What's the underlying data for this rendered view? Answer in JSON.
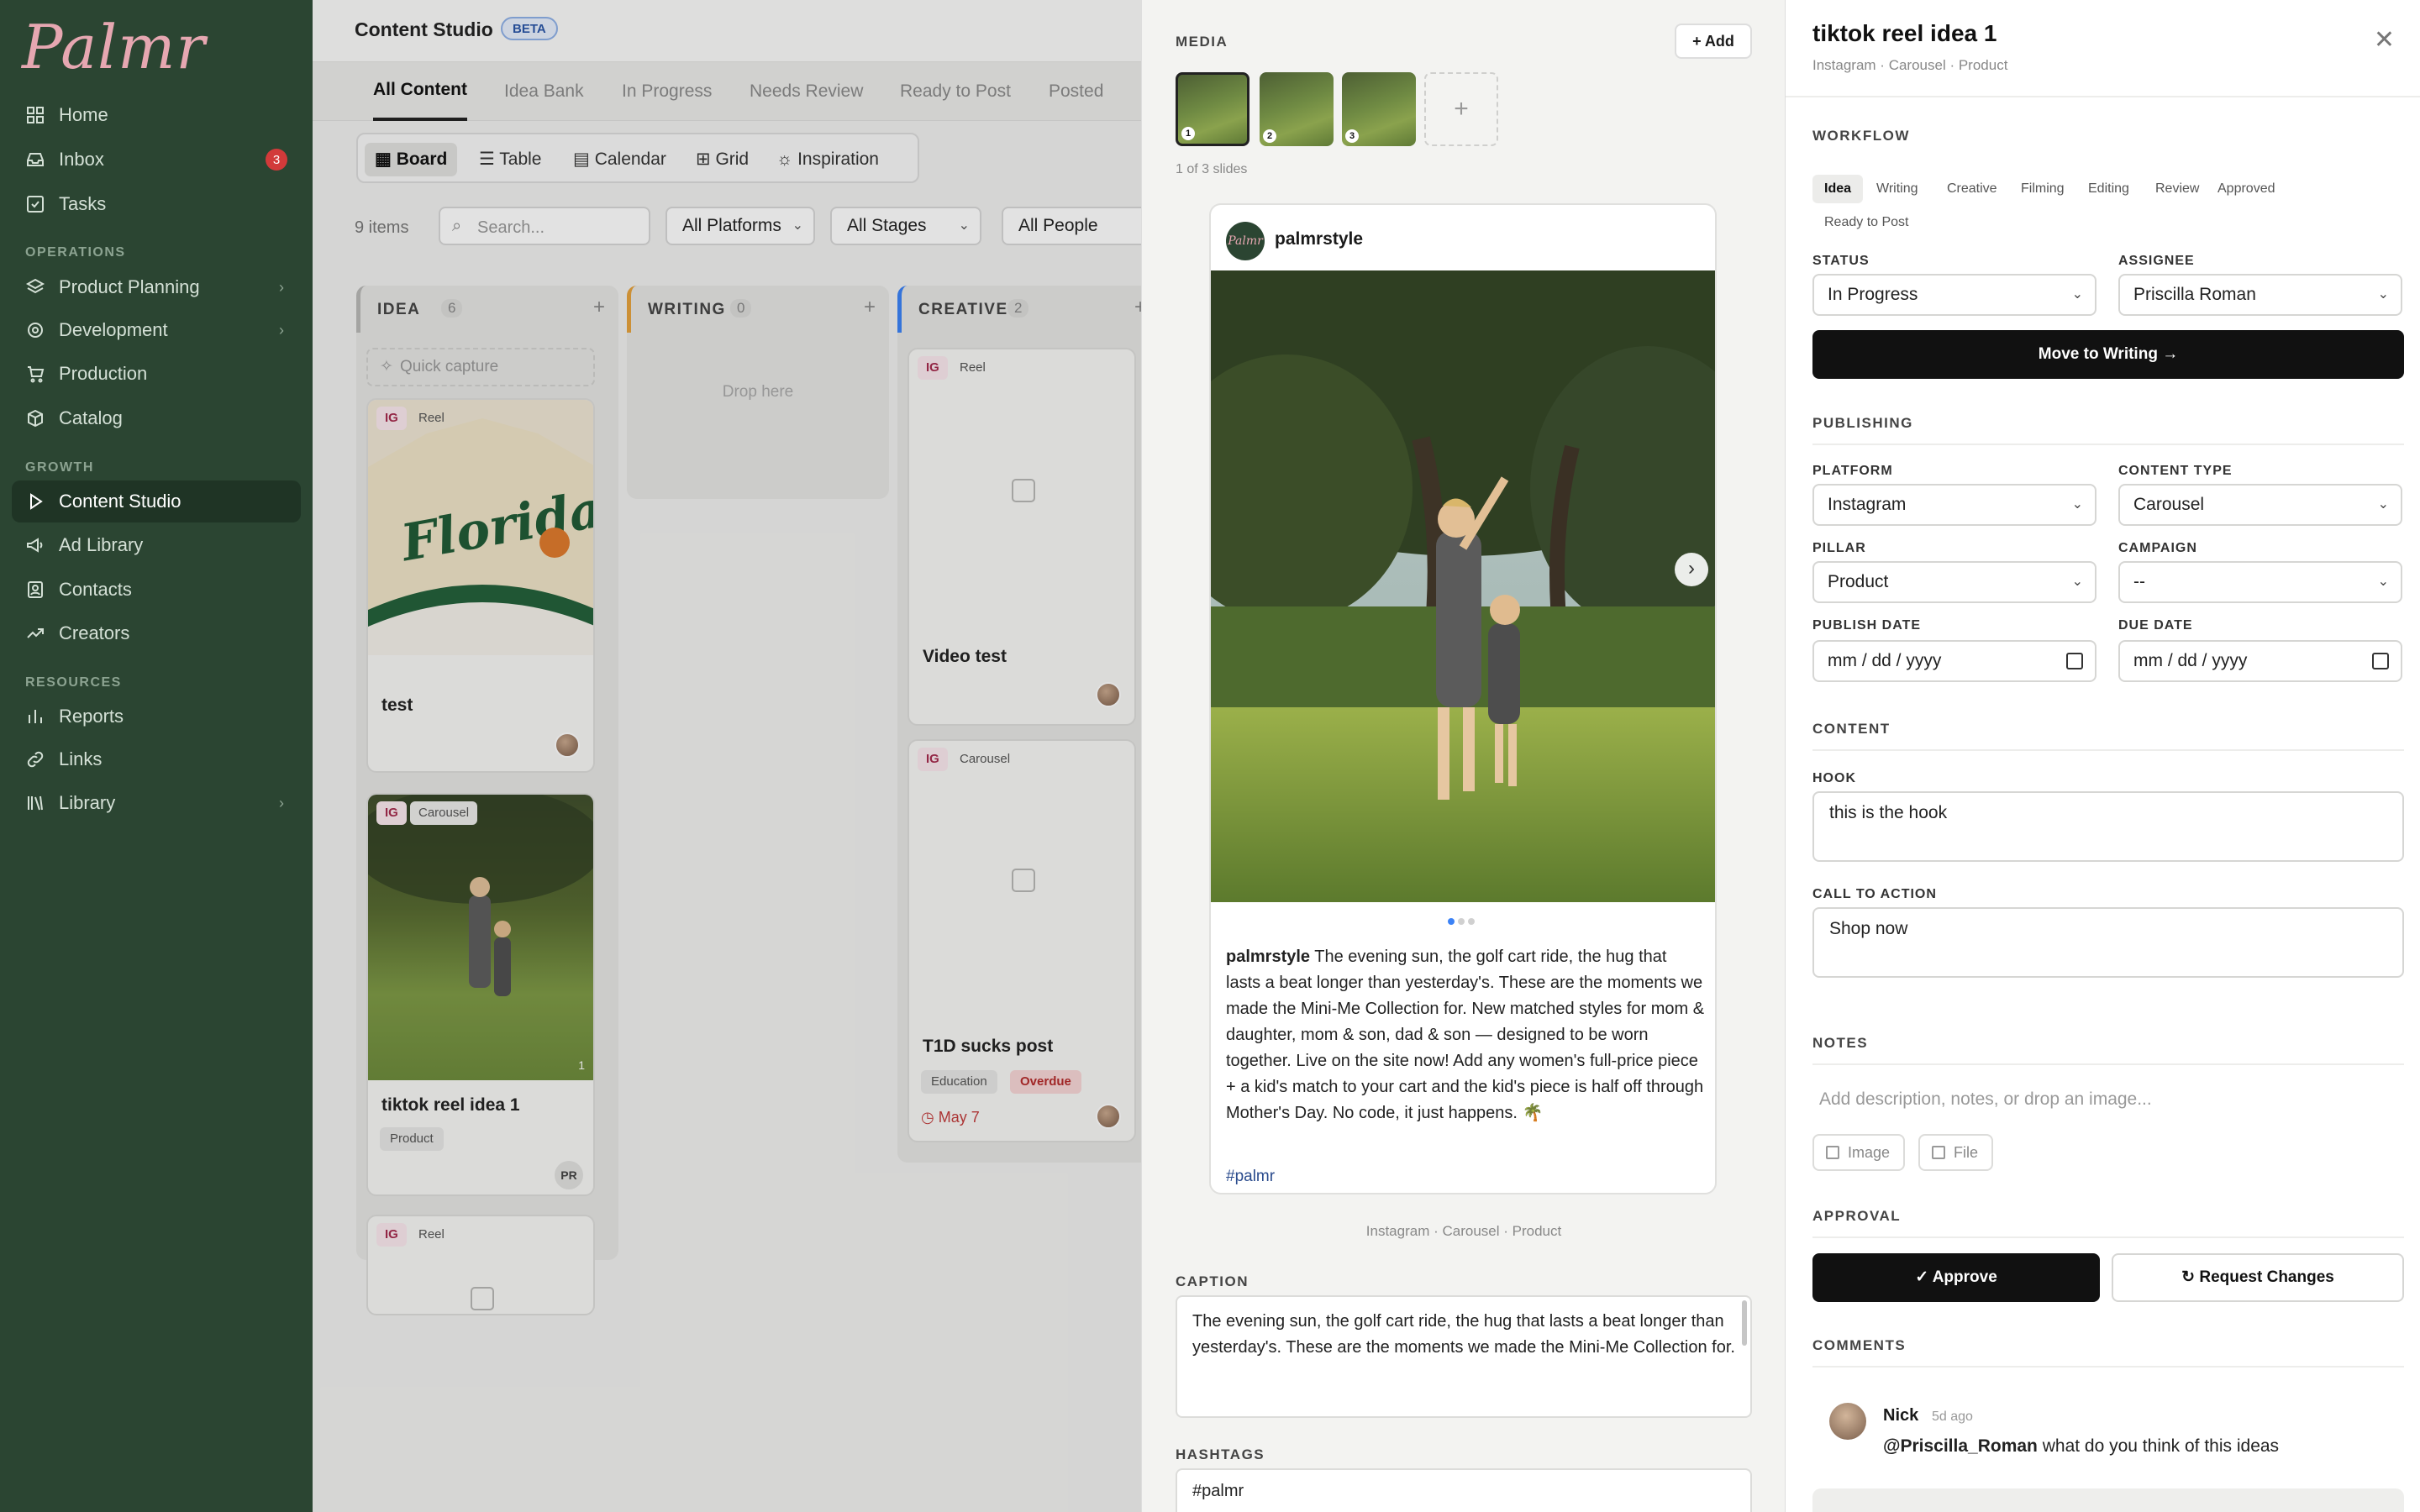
{
  "app": {
    "logo": "Palmr"
  },
  "sidebar": {
    "items": [
      {
        "label": "Home",
        "icon": "grid-icon"
      },
      {
        "label": "Inbox",
        "icon": "inbox-icon",
        "badge": "3"
      },
      {
        "label": "Tasks",
        "icon": "checkbox-icon"
      },
      {
        "label": "Product Planning",
        "icon": "layers-icon"
      },
      {
        "label": "Development",
        "icon": "gear-icon"
      },
      {
        "label": "Production",
        "icon": "cart-icon"
      },
      {
        "label": "Catalog",
        "icon": "box-icon"
      },
      {
        "label": "Content Studio",
        "icon": "play-icon"
      },
      {
        "label": "Ad Library",
        "icon": "megaphone-icon"
      },
      {
        "label": "Contacts",
        "icon": "contact-icon"
      },
      {
        "label": "Creators",
        "icon": "trend-icon"
      },
      {
        "label": "Reports",
        "icon": "bar-chart-icon"
      },
      {
        "label": "Links",
        "icon": "link-icon"
      },
      {
        "label": "Library",
        "icon": "books-icon"
      }
    ],
    "sections": {
      "operations": "OPERATIONS",
      "growth": "GROWTH",
      "resources": "RESOURCES"
    }
  },
  "main": {
    "title": "Content Studio",
    "beta": "BETA",
    "tabs": [
      "All Content",
      "Idea Bank",
      "In Progress",
      "Needs Review",
      "Ready to Post",
      "Posted"
    ],
    "views": [
      "Board",
      "Table",
      "Calendar",
      "Grid",
      "Inspiration"
    ],
    "items_count": "9 items",
    "search_placeholder": "Search...",
    "filters": [
      "All Platforms",
      "All Stages",
      "All People"
    ],
    "columns": [
      {
        "title": "IDEA",
        "count": "6",
        "color": "#b9b9b7"
      },
      {
        "title": "WRITING",
        "count": "0",
        "color": "#e6a23c"
      },
      {
        "title": "CREATIVE",
        "count": "2",
        "color": "#3b82f6"
      }
    ],
    "quick_capture": "Quick capture",
    "drop_here": "Drop here",
    "cards": {
      "test": {
        "platform": "IG",
        "format": "Reel",
        "title": "test",
        "art": "Florida"
      },
      "tiktok": {
        "platform": "IG",
        "format": "Carousel",
        "title": "tiktok reel idea 1",
        "tag": "Product",
        "assignee": "PR",
        "slides": "1"
      },
      "reel3": {
        "platform": "IG",
        "format": "Reel"
      },
      "video": {
        "platform": "IG",
        "format": "Reel",
        "title": "Video test"
      },
      "t1d": {
        "platform": "IG",
        "format": "Carousel",
        "title": "T1D sucks post",
        "tags": [
          "Education",
          "Overdue"
        ],
        "due": "May 7"
      }
    }
  },
  "media": {
    "label": "MEDIA",
    "add": "Add",
    "thumbs": [
      "1",
      "2",
      "3"
    ],
    "slides": "1 of 3 slides",
    "post": {
      "username": "palmrstyle",
      "avatar_text": "Palmr",
      "caption": "The evening sun, the golf cart ride, the hug that lasts a beat longer than yesterday's. These are the moments we made the Mini-Me Collection for. New matched styles for mom & daughter, mom & son, dad & son — designed to be worn together. Live on the site now! Add any women's full-price piece + a kid's match to your cart and the kid's piece is half off through Mother's Day. No code, it just happens. 🌴",
      "hashtag": "#palmr"
    },
    "meta": "Instagram  ·  Carousel  ·  Product",
    "caption_label": "CAPTION",
    "caption_value": "The evening sun, the golf cart ride, the hug that lasts a beat longer than yesterday's. These are the moments we made the Mini-Me Collection for.",
    "hashtags_label": "HASHTAGS",
    "hashtags_value": "#palmr"
  },
  "detail": {
    "title": "tiktok reel idea 1",
    "subtitle": "Instagram  ·  Carousel  ·  Product",
    "workflow_label": "WORKFLOW",
    "stages": [
      "Idea",
      "Writing",
      "Creative",
      "Filming",
      "Editing",
      "Review",
      "Approved",
      "Ready to Post"
    ],
    "status_label": "STATUS",
    "status": "In Progress",
    "assignee_label": "ASSIGNEE",
    "assignee": "Priscilla Roman",
    "move_button": "Move to Writing",
    "publishing_label": "PUBLISHING",
    "platform_label": "PLATFORM",
    "platform": "Instagram",
    "content_type_label": "CONTENT TYPE",
    "content_type": "Carousel",
    "pillar_label": "PILLAR",
    "pillar": "Product",
    "campaign_label": "CAMPAIGN",
    "campaign": "--",
    "publish_date_label": "PUBLISH DATE",
    "publish_date": "mm / dd / yyyy",
    "due_date_label": "DUE DATE",
    "due_date": "mm / dd / yyyy",
    "content_label": "CONTENT",
    "hook_label": "HOOK",
    "hook": "this is the hook",
    "cta_label": "CALL TO ACTION",
    "cta": "Shop now",
    "notes_label": "NOTES",
    "notes_placeholder": "Add description, notes, or drop an image...",
    "image_btn": "Image",
    "file_btn": "File",
    "approval_label": "APPROVAL",
    "approve": "Approve",
    "request_changes": "Request Changes",
    "comments_label": "COMMENTS",
    "comment": {
      "author": "Nick",
      "time": "5d ago",
      "mention": "@Priscilla_Roman",
      "text": " what do you think of this ideas"
    }
  }
}
